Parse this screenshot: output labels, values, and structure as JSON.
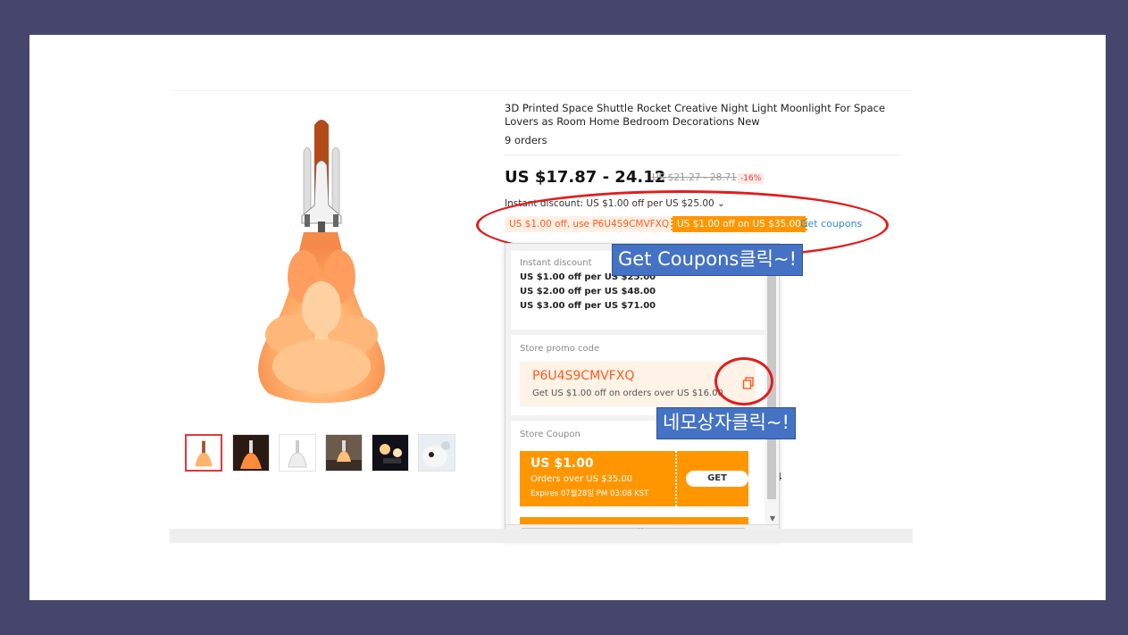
{
  "product": {
    "title": "3D Printed Space Shuttle Rocket Creative Night Light Moonlight For Space Lovers as Room Home Bedroom Decorations New",
    "orders": "9 orders",
    "price": "US $17.87 - 24.12",
    "old_price": "US $21.27 - 28.71",
    "discount_pct": "-16%",
    "instant_discount": "Instant discount: US $1.00 off per US $25.00 ⌄",
    "tag_promo": "US $1.00 off, use P6U4S9CMVFXQ",
    "tag_coupon": "US $1.00 off on US $35.00",
    "get_coupons_link": "Get coupons",
    "quantity_fragment": "4"
  },
  "panel": {
    "instant_label": "Instant discount",
    "instant_lines": [
      "US $1.00 off per US $25.00",
      "US $2.00 off per US $48.00",
      "US $3.00 off per US $71.00"
    ],
    "promo_label": "Store promo code",
    "promo_code": "P6U4S9CMVFXQ",
    "promo_desc": "Get US $1.00 off on orders over US $16.00",
    "coupon_label": "Store Coupon",
    "coupon": {
      "amount": "US $1.00",
      "condition": "Orders over US $35.00",
      "expires": "Expires 07월28일 PM 03:08 KST",
      "button": "GET"
    },
    "more_icon": "»"
  },
  "annotations": {
    "callout_get_coupons": "Get Coupons클릭~!",
    "callout_copy": "네모상자클릭~!"
  },
  "icons": [
    "copy-icon",
    "chevron-down-double-icon",
    "scroll-arrow-icon"
  ],
  "colors": {
    "slide_border": "#46466c",
    "accent_orange": "#ff9600",
    "promo_text": "#ff5b1b",
    "callout_blue": "#4472c4",
    "highlight_red": "#e01e1e"
  }
}
